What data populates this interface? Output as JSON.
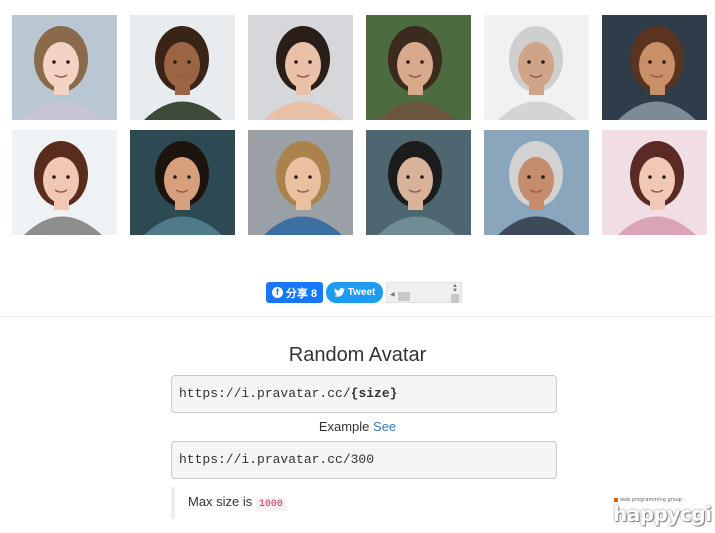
{
  "avatars": [
    {
      "name": "avatar-girl-cosplay",
      "bg": "#b9c7d3",
      "hair": "#8a6a4a",
      "skin": "#f2d3c4",
      "shirt": "#c9c3d6"
    },
    {
      "name": "avatar-girl-curly",
      "bg": "#e9ecef",
      "hair": "#3a2416",
      "skin": "#9b6545",
      "shirt": "#3d4a3a"
    },
    {
      "name": "avatar-woman-dark-hair",
      "bg": "#d5d7da",
      "hair": "#2b1d17",
      "skin": "#e9c0a8",
      "shirt": "#e9c0a8"
    },
    {
      "name": "avatar-woman-curly-profile",
      "bg": "#4c6b3e",
      "hair": "#3b2a1e",
      "skin": "#d8a98a",
      "shirt": "#6b5640"
    },
    {
      "name": "avatar-old-man-beard",
      "bg": "#f1f1f1",
      "hair": "#cfcfcf",
      "skin": "#cfa487",
      "shirt": "#d4d4d4"
    },
    {
      "name": "avatar-man-beard",
      "bg": "#2f3c4a",
      "hair": "#5a3420",
      "skin": "#c98f68",
      "shirt": "#7c8b96"
    },
    {
      "name": "avatar-woman-smiling",
      "bg": "#eef2f4",
      "hair": "#5a2c1d",
      "skin": "#f0c8b4",
      "shirt": "#8d8f8c"
    },
    {
      "name": "avatar-toddler",
      "bg": "#2d4a52",
      "hair": "#1d1410",
      "skin": "#d6a07c",
      "shirt": "#4f7a8a"
    },
    {
      "name": "avatar-teen-beanie",
      "bg": "#9aa0a6",
      "hair": "#a9834b",
      "skin": "#e9c0a0",
      "shirt": "#3d6fa2"
    },
    {
      "name": "avatar-man-water",
      "bg": "#4e6670",
      "hair": "#1c1c1c",
      "skin": "#d8b39a",
      "shirt": "#6f8c95"
    },
    {
      "name": "avatar-old-man-smiling",
      "bg": "#8aa6bd",
      "hair": "#d2d2d2",
      "skin": "#c58d6d",
      "shirt": "#3c4a5a"
    },
    {
      "name": "avatar-woman-headband",
      "bg": "#f1dde4",
      "hair": "#5b2a24",
      "skin": "#f1c8b5",
      "shirt": "#d9a3b8"
    }
  ],
  "social": {
    "share_label": "分享 8",
    "fb_glyph": "f",
    "tweet_label": "Tweet"
  },
  "main": {
    "title": "Random Avatar",
    "url_prefix": "https://i.pravatar.cc/",
    "url_param": "{size}",
    "example_label": "Example",
    "example_link": "See",
    "example_url": "https://i.pravatar.cc/300",
    "note_text": "Max size is",
    "note_code": "1000"
  },
  "watermark": {
    "tagline": "web programming group",
    "brand": "happycgi"
  },
  "colors": {
    "link": "#337ab7",
    "facebook": "#1877f2",
    "twitter": "#1d9bf0",
    "code_text": "#c7254e"
  }
}
